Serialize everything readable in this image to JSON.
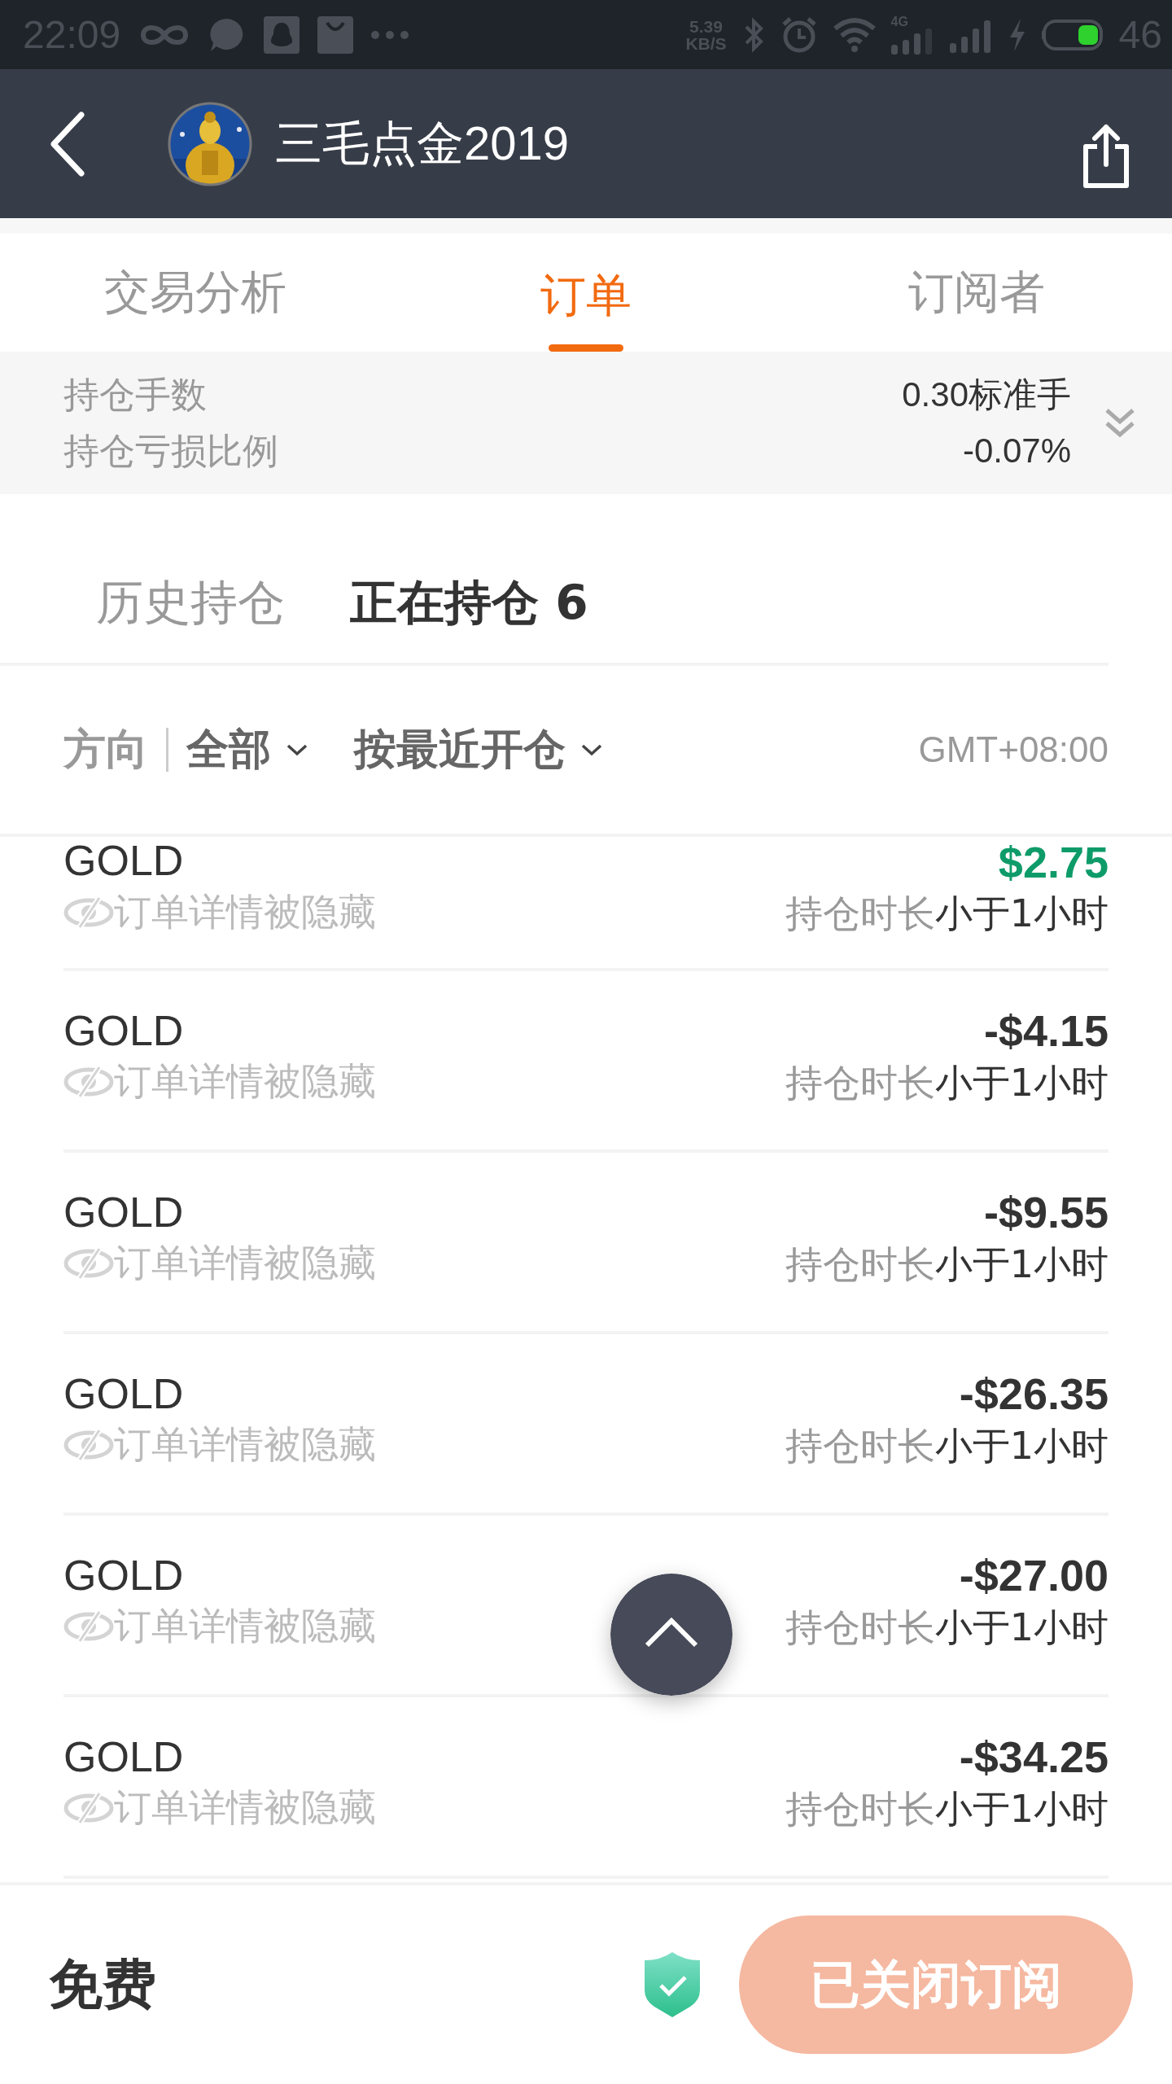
{
  "status_bar": {
    "time": "22:09",
    "speed_value": "5.39",
    "speed_unit": "KB/S",
    "network": "4G",
    "battery": "46"
  },
  "header": {
    "title": "三毛点金2019"
  },
  "tabs": [
    {
      "label": "交易分析",
      "selected": false
    },
    {
      "label": "订单",
      "selected": true
    },
    {
      "label": "订阅者",
      "selected": false
    }
  ],
  "summary": {
    "rows": [
      {
        "label": "持仓手数",
        "value": "0.30标准手"
      },
      {
        "label": "持仓亏损比例",
        "value": "-0.07%"
      }
    ],
    "expanded": false
  },
  "sub_tabs": [
    {
      "label": "历史持仓",
      "selected": false
    },
    {
      "label": "正在持仓 6",
      "selected": true
    }
  ],
  "filters": {
    "direction_label": "方向",
    "direction_value": "全部",
    "sort_value": "按最近开仓",
    "timezone": "GMT+08:00"
  },
  "orders": [
    {
      "symbol": "GOLD",
      "note": "订单详情被隐藏",
      "profit": "$2.75",
      "kind": "gain",
      "duration_label": "持仓时长",
      "duration": "小于1小时"
    },
    {
      "symbol": "GOLD",
      "note": "订单详情被隐藏",
      "profit": "-$4.15",
      "kind": "loss",
      "duration_label": "持仓时长",
      "duration": "小于1小时"
    },
    {
      "symbol": "GOLD",
      "note": "订单详情被隐藏",
      "profit": "-$9.55",
      "kind": "loss",
      "duration_label": "持仓时长",
      "duration": "小于1小时"
    },
    {
      "symbol": "GOLD",
      "note": "订单详情被隐藏",
      "profit": "-$26.35",
      "kind": "loss",
      "duration_label": "持仓时长",
      "duration": "小于1小时"
    },
    {
      "symbol": "GOLD",
      "note": "订单详情被隐藏",
      "profit": "-$27.00",
      "kind": "loss",
      "duration_label": "持仓时长",
      "duration": "小于1小时"
    },
    {
      "symbol": "GOLD",
      "note": "订单详情被隐藏",
      "profit": "-$34.25",
      "kind": "loss",
      "duration_label": "持仓时长",
      "duration": "小于1小时"
    }
  ],
  "footer": {
    "price": "免费",
    "button": {
      "label": "已关闭订阅",
      "disabled": true
    }
  }
}
